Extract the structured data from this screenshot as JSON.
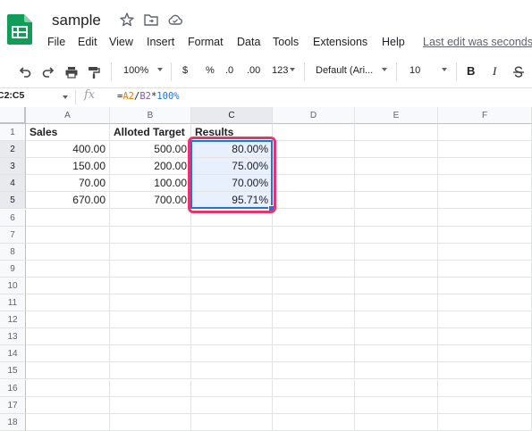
{
  "doc": {
    "title": "sample",
    "last_edit": "Last edit was seconds"
  },
  "menu": [
    "File",
    "Edit",
    "View",
    "Insert",
    "Format",
    "Data",
    "Tools",
    "Extensions",
    "Help"
  ],
  "toolbar": {
    "zoom": "100%",
    "currency": "$",
    "percent": "%",
    "decrease_decimal": ".0",
    "increase_decimal": ".00",
    "more_formats": "123",
    "font": "Default (Ari...",
    "font_size": "10",
    "bold": "B",
    "italic": "I"
  },
  "formula_bar": {
    "name_box": "C2:C5",
    "fx": "fx",
    "formula_eq": "=",
    "formula_ref1": "A2",
    "formula_op1": "/",
    "formula_ref2": "B2",
    "formula_op2": "*",
    "formula_num": "100%"
  },
  "columns": [
    "A",
    "B",
    "C",
    "D",
    "E",
    "F"
  ],
  "row_numbers": [
    "1",
    "2",
    "3",
    "4",
    "5",
    "6",
    "7",
    "8",
    "9",
    "10",
    "11",
    "12",
    "13",
    "14",
    "15",
    "16",
    "17",
    "18"
  ],
  "cells": {
    "A1": "Sales",
    "B1": "Alloted Target",
    "C1": "Results",
    "A2": "400.00",
    "B2": "500.00",
    "C2": "80.00%",
    "A3": "150.00",
    "B3": "200.00",
    "C3": "75.00%",
    "A4": "70.00",
    "B4": "100.00",
    "C4": "70.00%",
    "A5": "670.00",
    "B5": "700.00",
    "C5": "95.71%"
  },
  "colors": {
    "selection": "#1a73e8",
    "highlight": "#e8336b",
    "sheets_green": "#0f9d58"
  }
}
